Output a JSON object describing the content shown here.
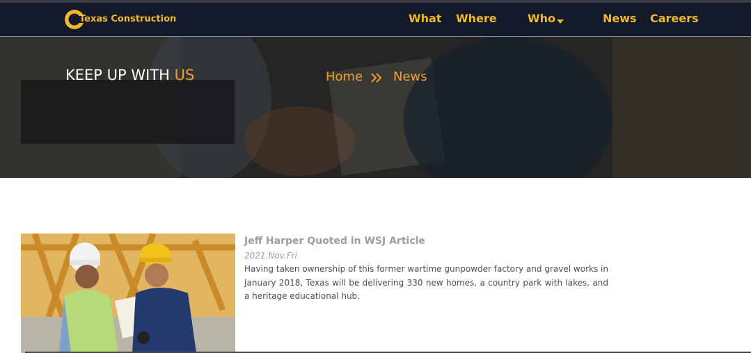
{
  "brand": {
    "name": "Texas Construction",
    "color": "#f0b92c"
  },
  "nav": {
    "what": "What",
    "where": "Where",
    "who": "Who",
    "news": "News",
    "careers": "Careers"
  },
  "hero": {
    "title_main": "KEEP UP WITH ",
    "title_accent": "US",
    "breadcrumb_home": "Home",
    "breadcrumb_current": "News"
  },
  "article": {
    "title": "Jeff Harper Quoted in WSJ Article",
    "date": "2021.Nov.Fri",
    "body": "Having taken ownership of this former wartime gunpowder factory and gravel works in January 2018, Texas will be delivering 330 new homes, a country park with lakes, and a heritage educational hub."
  },
  "colors": {
    "navbar": "#141a29",
    "accent": "#f0a12c"
  }
}
